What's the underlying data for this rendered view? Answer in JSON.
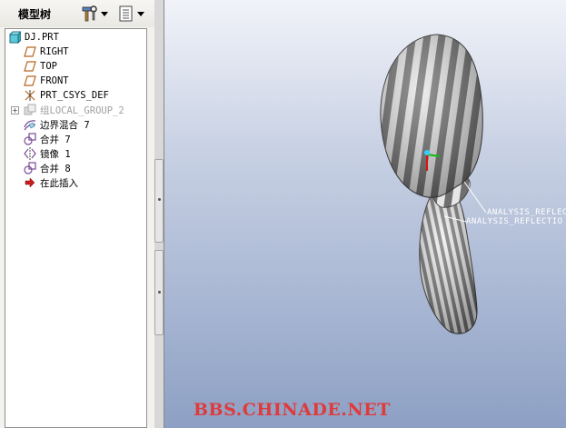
{
  "panel": {
    "title": "模型树",
    "tools_icon": "hammer-wrench-icon",
    "show_icon": "list-settings-icon"
  },
  "tree": {
    "root": "DJ.PRT",
    "items": [
      {
        "label": "RIGHT",
        "icon": "datum-plane-icon"
      },
      {
        "label": "TOP",
        "icon": "datum-plane-icon"
      },
      {
        "label": "FRONT",
        "icon": "datum-plane-icon"
      },
      {
        "label": "PRT_CSYS_DEF",
        "icon": "csys-icon"
      },
      {
        "label": "组LOCAL_GROUP_2",
        "icon": "group-icon",
        "suppressed": true
      },
      {
        "label": "边界混合 7",
        "icon": "boundary-blend-icon"
      },
      {
        "label": "合并 7",
        "icon": "merge-icon"
      },
      {
        "label": "镜像 1",
        "icon": "mirror-icon"
      },
      {
        "label": "合并 8",
        "icon": "merge-icon"
      },
      {
        "label": "在此插入",
        "icon": "insert-here-arrow-icon"
      }
    ]
  },
  "viewport": {
    "callouts": [
      "ANALYSIS_REFLEC",
      "ANALYSIS_REFLECTIO"
    ],
    "watermark": "BBS.CHINADE.NET"
  },
  "colors": {
    "watermark": "#e03a3a",
    "bg_top": "#f1f3f9",
    "bg_bottom": "#8da0c4"
  }
}
